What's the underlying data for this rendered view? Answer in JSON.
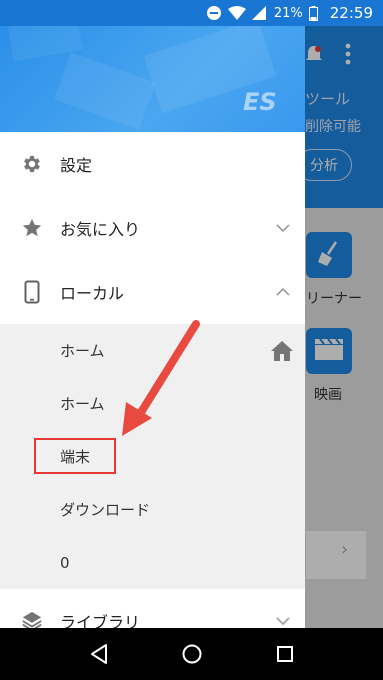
{
  "status_bar": {
    "battery_percent": "21%",
    "time": "22:59"
  },
  "background_app": {
    "tool_label": "ツール",
    "deletable_label": "削除可能",
    "analyze_button": "分析",
    "cleaner_label": "リーナー",
    "movie_label": "映画"
  },
  "drawer": {
    "items": [
      {
        "label": "設定",
        "icon": "gear-icon"
      },
      {
        "label": "お気に入り",
        "icon": "star-icon",
        "expanded": false
      },
      {
        "label": "ローカル",
        "icon": "phone-icon",
        "expanded": true
      }
    ],
    "local_subitems": [
      {
        "label": "ホーム"
      },
      {
        "label": "ホーム"
      },
      {
        "label": "端末",
        "highlighted": true
      },
      {
        "label": "ダウンロード"
      },
      {
        "label": "0"
      }
    ],
    "library": {
      "label": "ライブラリ",
      "icon": "layers-icon",
      "expanded": false
    }
  },
  "colors": {
    "status_bar": "#1976d2",
    "header_blue": "#1e88e5",
    "highlight": "#e53935",
    "arrow": "#e84a3f"
  }
}
